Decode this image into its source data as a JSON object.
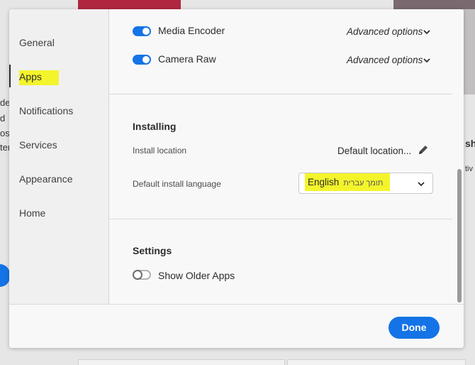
{
  "background": {
    "left_fragments": [
      "de",
      "d",
      "ost",
      "ter"
    ],
    "right_fragments": [
      "sh",
      "tiv"
    ]
  },
  "sidebar": {
    "items": [
      {
        "label": "General",
        "active": false
      },
      {
        "label": "Apps",
        "active": true
      },
      {
        "label": "Notifications",
        "active": false
      },
      {
        "label": "Services",
        "active": false
      },
      {
        "label": "Appearance",
        "active": false
      },
      {
        "label": "Home",
        "active": false
      }
    ]
  },
  "apps": [
    {
      "name": "Media Encoder",
      "enabled": true,
      "options_label": "Advanced options"
    },
    {
      "name": "Camera Raw",
      "enabled": true,
      "options_label": "Advanced options"
    }
  ],
  "installing": {
    "title": "Installing",
    "location_label": "Install location",
    "location_value": "Default location...",
    "language_label": "Default install language",
    "language_value": "English",
    "language_secondary": "תומך עברית"
  },
  "settings": {
    "title": "Settings",
    "show_older_apps_label": "Show Older Apps",
    "show_older_apps": false
  },
  "footer": {
    "done_label": "Done"
  },
  "colors": {
    "accent": "#1473e6",
    "highlight": "#f4f42c"
  }
}
